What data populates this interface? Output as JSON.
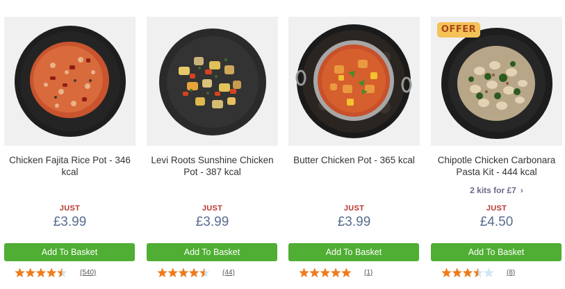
{
  "products": [
    {
      "title": "Chicken Fajita Rice Pot - 346 kcal",
      "badge": "",
      "promo": "",
      "price_prefix": "JUST",
      "price": "£3.99",
      "button_label": "Add To Basket",
      "rating": 4.5,
      "review_count": "(540)",
      "image": "chicken-fajita-rice-pot"
    },
    {
      "title": "Levi Roots Sunshine Chicken Pot - 387 kcal",
      "badge": "",
      "promo": "",
      "price_prefix": "JUST",
      "price": "£3.99",
      "button_label": "Add To Basket",
      "rating": 4.5,
      "review_count": "(44)",
      "image": "sunshine-chicken-pot"
    },
    {
      "title": "Butter Chicken Pot - 365 kcal",
      "badge": "",
      "promo": "",
      "price_prefix": "JUST",
      "price": "£3.99",
      "button_label": "Add To Basket",
      "rating": 5,
      "review_count": "(1)",
      "image": "butter-chicken-pot"
    },
    {
      "title": "Chipotle Chicken Carbonara Pasta Kit - 444 kcal",
      "badge": "OFFER",
      "promo": "2 kits for £7",
      "price_prefix": "JUST",
      "price": "£4.50",
      "button_label": "Add To Basket",
      "rating": 3.5,
      "review_count": "(8)",
      "image": "carbonara-pasta-kit"
    }
  ],
  "colors": {
    "button": "#4fae33",
    "price": "#596c8e",
    "just": "#b8372f",
    "star": "#f07b1a",
    "star_empty": "#cfe6f3",
    "offer_badge": "#f4c257",
    "promo": "#6a6a8e"
  },
  "icons": {
    "promo_arrow": "chevron-right-icon",
    "rating": "star-icon"
  }
}
